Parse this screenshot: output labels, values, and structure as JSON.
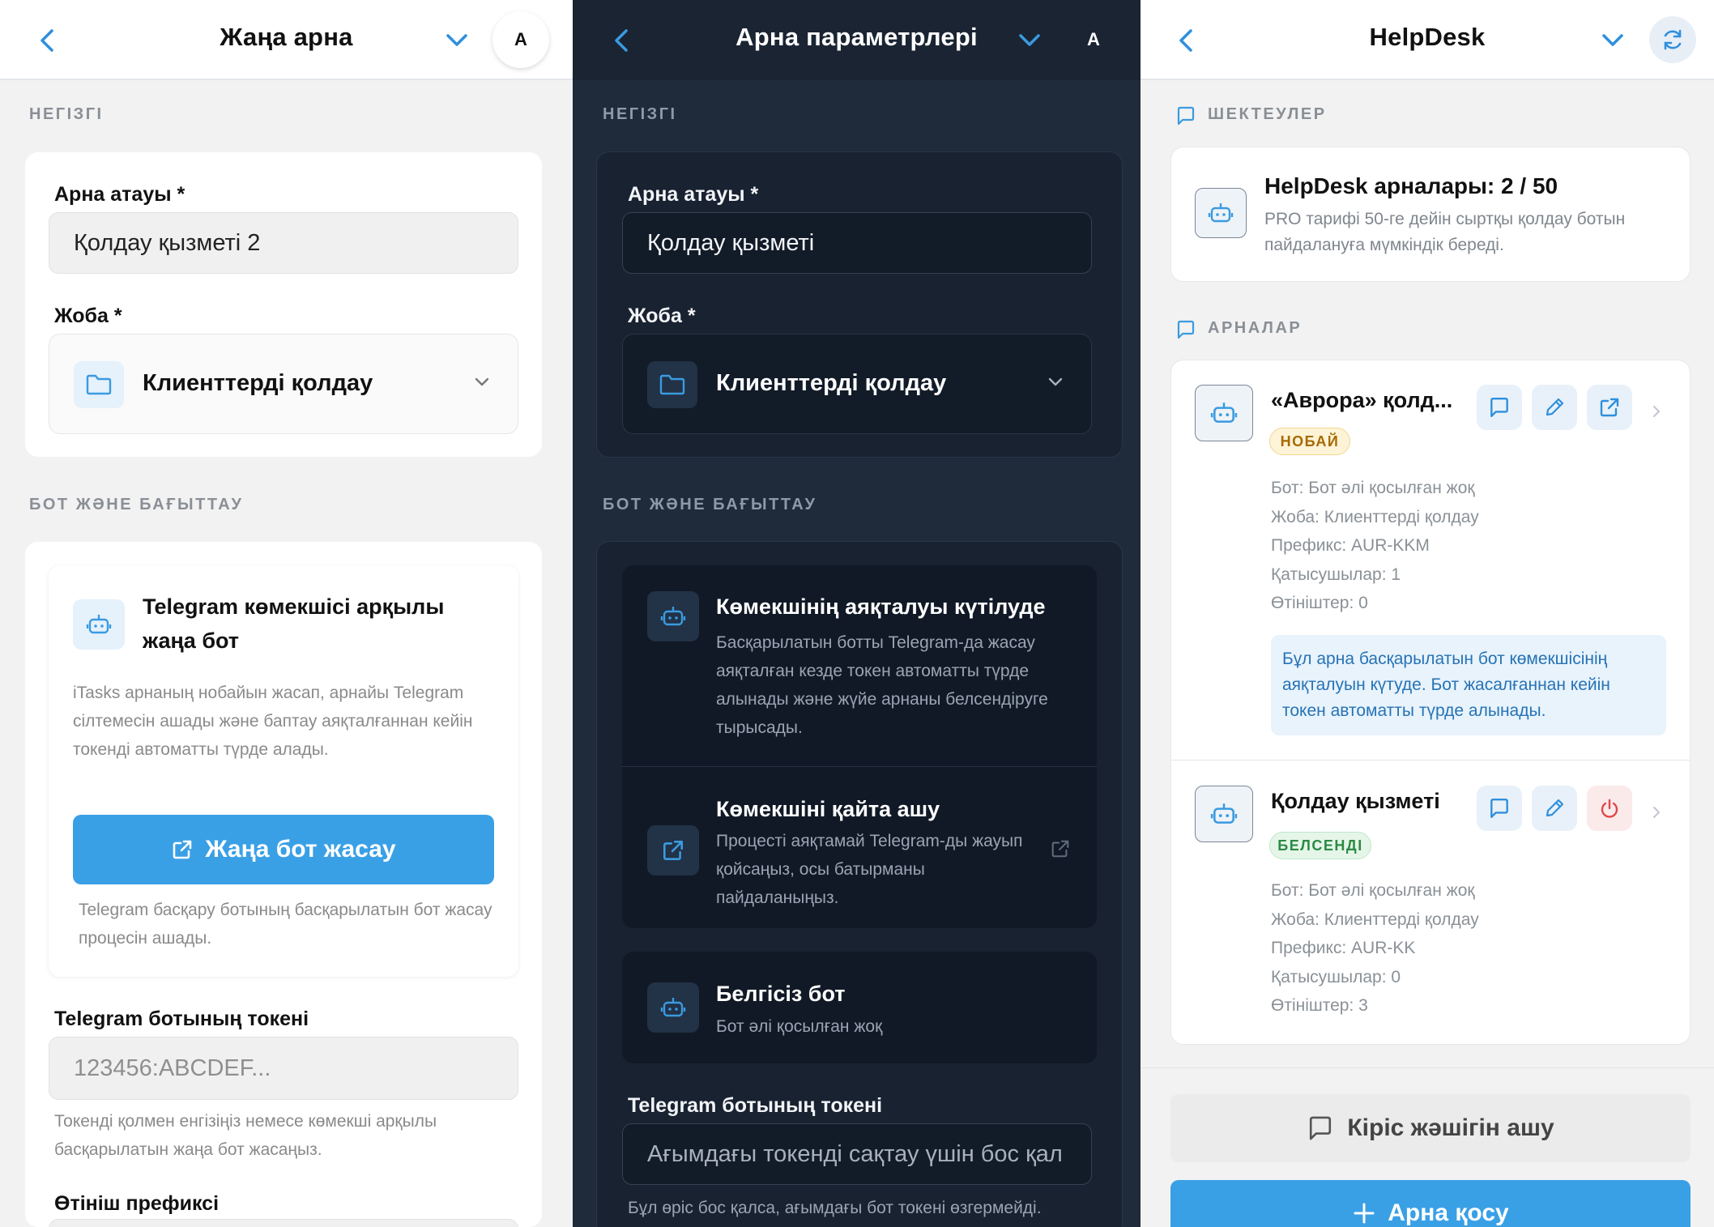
{
  "panels": {
    "new_channel": {
      "title": "Жаңа арна",
      "avatar": "A",
      "sections": {
        "basic": "НЕГІЗГІ",
        "bot": "БОТ ЖӘНЕ БАҒЫТТАУ"
      },
      "name_label": "Арна атауы *",
      "name_value": "Қолдау қызметі 2",
      "project_label": "Жоба *",
      "project_value": "Клиенттерді қолдау",
      "new_bot_title": "Telegram көмекшісі арқылы жаңа бот",
      "new_bot_desc": "iTasks арнаның нобайын жасап, арнайы Telegram сілтемесін ашады және баптау аяқталғаннан кейін токенді автоматты түрде алады.",
      "create_bot_button": "Жаңа бот жасау",
      "create_bot_note": "Telegram басқару ботының басқарылатын бот жасау процесін ашады.",
      "token_label": "Telegram ботының токені",
      "token_placeholder": "123456:ABCDEF...",
      "token_note": "Токенді қолмен енгізіңіз немесе көмекші арқылы басқарылатын жаңа бот жасаңыз.",
      "prefix_label": "Өтініш префиксі"
    },
    "channel_settings": {
      "title": "Арна параметрлері",
      "avatar": "A",
      "sections": {
        "basic": "НЕГІЗГІ",
        "bot": "БОТ ЖӘНЕ БАҒЫТТАУ"
      },
      "name_label": "Арна атауы *",
      "name_value": "Қолдау қызметі",
      "project_label": "Жоба *",
      "project_value": "Клиенттерді қолдау",
      "waiting_title": "Көмекшінің аяқталуы күтілуде",
      "waiting_desc": "Басқарылатын ботты Telegram-да жасау аяқталған кезде токен автоматты түрде алынады және жүйе арнаны белсендіруге тырысады.",
      "reopen_title": "Көмекшіні қайта ашу",
      "reopen_desc": "Процесті аяқтамай Telegram-ды жауып қойсаңыз, осы батырманы пайдаланыңыз.",
      "unknown_title": "Белгісіз бот",
      "unknown_desc": "Бот әлі қосылған жоқ",
      "token_label": "Telegram ботының токені",
      "token_placeholder": "Ағымдағы токенді сақтау үшін бос қал",
      "token_note": "Бұл өріс бос қалса, ағымдағы бот токені өзгермейді."
    },
    "helpdesk": {
      "title": "HelpDesk",
      "sections": {
        "limits": "ШЕКТЕУЛЕР",
        "channels": "АРНАЛАР"
      },
      "limit_title": "HelpDesk арналары: 2 / 50",
      "limit_desc": "PRO тарифі 50-ге дейін сыртқы қолдау ботын пайдалануға мүмкіндік береді.",
      "channels": [
        {
          "name": "«Аврора» қолд...",
          "badge": "НОБАЙ",
          "bot": "Бот: Бот әлі қосылған жоқ",
          "project": "Жоба: Клиенттерді қолдау",
          "prefix": "Префикс: AUR-KKM",
          "members": "Қатысушылар: 1",
          "requests": "Өтініштер: 0",
          "info": "Бұл арна басқарылатын бот көмекшісінің аяқталуын күтуде. Бот жасалғаннан кейін токен автоматты түрде алынады."
        },
        {
          "name": "Қолдау қызметі",
          "badge": "БЕЛСЕНДІ",
          "bot": "Бот: Бот әлі қосылған жоқ",
          "project": "Жоба: Клиенттерді қолдау",
          "prefix": "Префикс: AUR-KK",
          "members": "Қатысушылар: 0",
          "requests": "Өтініштер: 3"
        }
      ],
      "open_inbox_button": "Кіріс жәшігін ашу",
      "add_channel_button": "Арна қосу"
    }
  },
  "colors": {
    "accent": "#3aa0e6",
    "dark_bg": "#1f2a3a",
    "light_bg": "#f2f2f2",
    "draft": "#a66a00",
    "active": "#2c8a43",
    "danger": "#e0484a"
  }
}
